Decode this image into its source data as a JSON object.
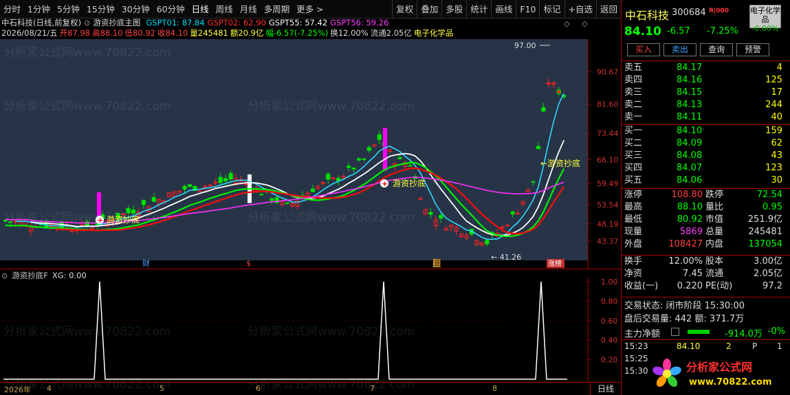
{
  "toolbar": {
    "left_items": [
      "分时",
      "1分钟",
      "5分钟",
      "15分钟",
      "30分钟",
      "60分钟",
      "日线",
      "周线",
      "月线",
      "多周期",
      "更多 >"
    ],
    "right_items": [
      "复权",
      "叠加",
      "多股",
      "统计",
      "画线",
      "F10",
      "标记",
      "+自选",
      "返回"
    ]
  },
  "info_line1": {
    "stock": "中石科技(日线,前复权)",
    "formula": "游资抄底主图",
    "gspt01": "GSPT01: 87.84",
    "gspt02": "GSPT02: 62.90",
    "gspt55": "GSPT55: 57.42",
    "gspt56": "GSPT56: 59.26"
  },
  "info_line2": {
    "date": "2026/08/21/五",
    "open": "开87.98",
    "high": "高88.10",
    "low": "低80.92",
    "close": "收84.10",
    "volume": "量245481",
    "amount": "额20.9亿",
    "range": "幅-6.57(-7.25%)",
    "turnover": "换12.00%",
    "float": "流通2.05亿",
    "industry": "电子化学品"
  },
  "price_axis": [
    "90.67",
    "81.60",
    "73.44",
    "66.10",
    "59.49",
    "53.54",
    "48.19",
    "43.37"
  ],
  "chart_annotations": {
    "high_label": "97.00",
    "low_label": "← 41.26",
    "signal_text": "游资抄底",
    "signal_text_arrow": "←游资抄底",
    "marker_cai": "财",
    "marker_s": "$",
    "marker_hui": "回",
    "marker_zhangbang": "涨榜"
  },
  "indicator": {
    "title": "游资抄底F",
    "xg": "XG: 0.00",
    "axis": [
      "1.00",
      "0.80",
      "0.60",
      "0.40",
      "0.20"
    ]
  },
  "xaxis": {
    "labels": [
      "2026年",
      "4",
      "5",
      "6",
      "7",
      "8"
    ],
    "period_button": "日线"
  },
  "quote": {
    "name": "中石科技",
    "code": "300684",
    "rz": "R|000",
    "industry_badge": "电子化学品",
    "industry_pct": "-0.00%",
    "price": "84.10",
    "change": "-6.57",
    "change_pct": "-7.25%",
    "buttons": [
      "买入",
      "卖出",
      "查询",
      "预警"
    ]
  },
  "order_book": {
    "asks": [
      {
        "label": "卖五",
        "price": "84.17",
        "vol": "4"
      },
      {
        "label": "卖四",
        "price": "84.16",
        "vol": "125"
      },
      {
        "label": "卖三",
        "price": "84.15",
        "vol": "17"
      },
      {
        "label": "卖二",
        "price": "84.13",
        "vol": "244"
      },
      {
        "label": "卖一",
        "price": "84.11",
        "vol": "40"
      }
    ],
    "bids": [
      {
        "label": "买一",
        "price": "84.10",
        "vol": "159"
      },
      {
        "label": "买二",
        "price": "84.09",
        "vol": "62"
      },
      {
        "label": "买三",
        "price": "84.08",
        "vol": "43"
      },
      {
        "label": "买四",
        "price": "84.07",
        "vol": "123"
      },
      {
        "label": "买五",
        "price": "84.06",
        "vol": "30"
      }
    ]
  },
  "stats": {
    "zhangting_l": "涨停",
    "zhangting_v": "108.80",
    "dieting_l": "跌停",
    "dieting_v": "72.54",
    "zuigao_l": "最高",
    "zuigao_v": "88.10",
    "liangbi_l": "量比",
    "liangbi_v": "0.95",
    "zuidi_l": "最低",
    "zuidi_v": "80.92",
    "shizhi_l": "市值",
    "shizhi_v": "251.9亿",
    "xianliang_l": "现量",
    "xianliang_v": "5869",
    "zongliang_l": "总量",
    "zongliang_v": "245481",
    "waipan_l": "外盘",
    "waipan_v": "108427",
    "neipan_l": "内盘",
    "neipan_v": "137054",
    "huanshou_l": "换手",
    "huanshou_v": "12.00%",
    "guben_l": "股本",
    "guben_v": "3.00亿",
    "jingzi_l": "净资",
    "jingzi_v": "7.45",
    "liutong_l": "流通",
    "liutong_v": "2.05亿",
    "shouyi_l": "收益(一)",
    "shouyi_v": "0.220",
    "pe_l": "PE(动)",
    "pe_v": "97.2"
  },
  "trade_status": {
    "state": "交易状态: 闭市阶段 15:30:00",
    "after_hours": "盘后交易量: 442  额: 371.7万"
  },
  "net_flow": {
    "label": "主力净额",
    "value": "-914.0万",
    "pct": "-0%"
  },
  "ticks": [
    {
      "time": "15:23",
      "price": "84.10",
      "vol": "2",
      "bs": "P",
      "n": "1"
    },
    {
      "time": "15:25",
      "price": "",
      "vol": "",
      "bs": "",
      "n": ""
    },
    {
      "time": "15:30",
      "price": "",
      "vol": "",
      "bs": "",
      "n": ""
    }
  ],
  "logo": {
    "title": "分析家公式网",
    "url": "www.70822.com"
  },
  "watermark": "分析家公式网www.70822.com",
  "colors": {
    "up": "#ff2020",
    "down": "#00ff00",
    "bg_panel": "#273447",
    "magenta": "#ff00ff",
    "yellow": "#ffff00"
  },
  "chart_data": {
    "type": "candlestick",
    "ylim": [
      41.26,
      97.0
    ],
    "y_ticks": [
      90.67,
      81.6,
      73.44,
      66.1,
      59.49,
      53.54,
      48.19,
      43.37
    ],
    "last": {
      "date": "2026/08/21",
      "open": 87.98,
      "high": 88.1,
      "low": 80.92,
      "close": 84.1
    },
    "high_marked": 97.0,
    "low_marked": 41.26,
    "indicator_lines": {
      "GSPT01": 87.84,
      "GSPT02": 62.9,
      "GSPT55": 57.42,
      "GSPT56": 59.26
    },
    "signals": [
      "游资抄底"
    ],
    "indicator_panel": {
      "name": "游资抄底F",
      "XG": 0.0
    }
  }
}
